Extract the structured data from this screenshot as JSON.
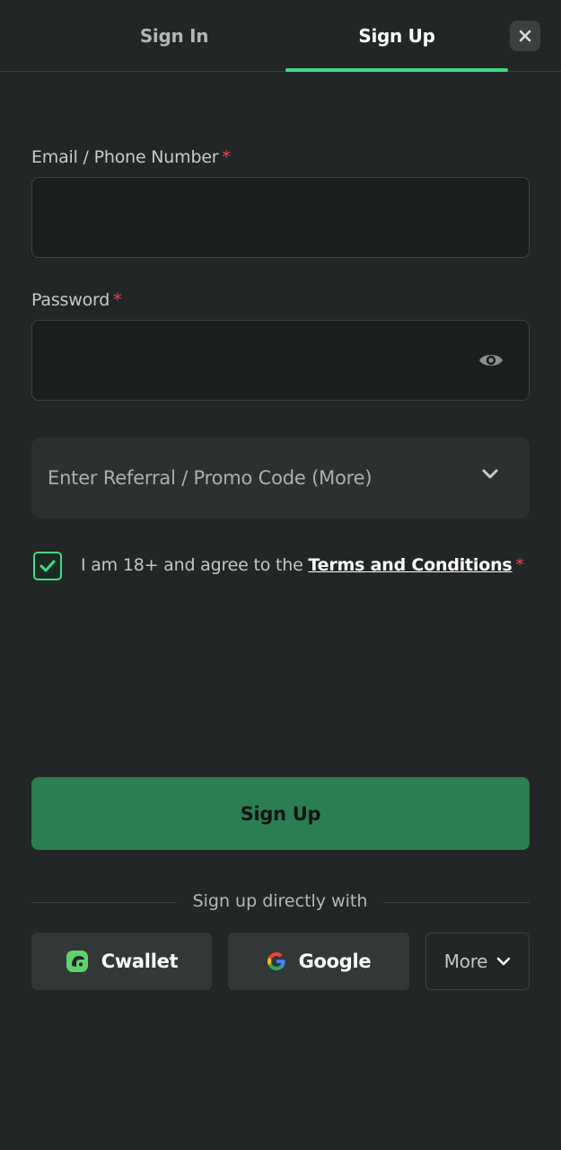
{
  "tabs": {
    "sign_in": "Sign In",
    "sign_up": "Sign Up",
    "active": "sign_up"
  },
  "form": {
    "email_label": "Email / Phone Number",
    "email_value": "",
    "password_label": "Password",
    "password_value": "",
    "required_mark": "*",
    "promo_label": "Enter Referral / Promo Code (More)",
    "agree_text": "I am 18+ and agree to the",
    "terms_link": "Terms and Conditions",
    "agree_checked": true,
    "submit_label": "Sign Up"
  },
  "social": {
    "divider_text": "Sign up directly with",
    "cwallet": "Cwallet",
    "google": "Google",
    "more": "More"
  },
  "icons": {
    "close": "close-icon",
    "eye": "eye-icon",
    "chevron": "chevron-down-icon",
    "check": "checkmark-icon",
    "cwallet": "cwallet-logo-icon",
    "google": "google-logo-icon"
  },
  "colors": {
    "background": "#232626",
    "accent": "#3ddc84",
    "primary_button": "#2b7e52",
    "required": "#e5484d"
  }
}
